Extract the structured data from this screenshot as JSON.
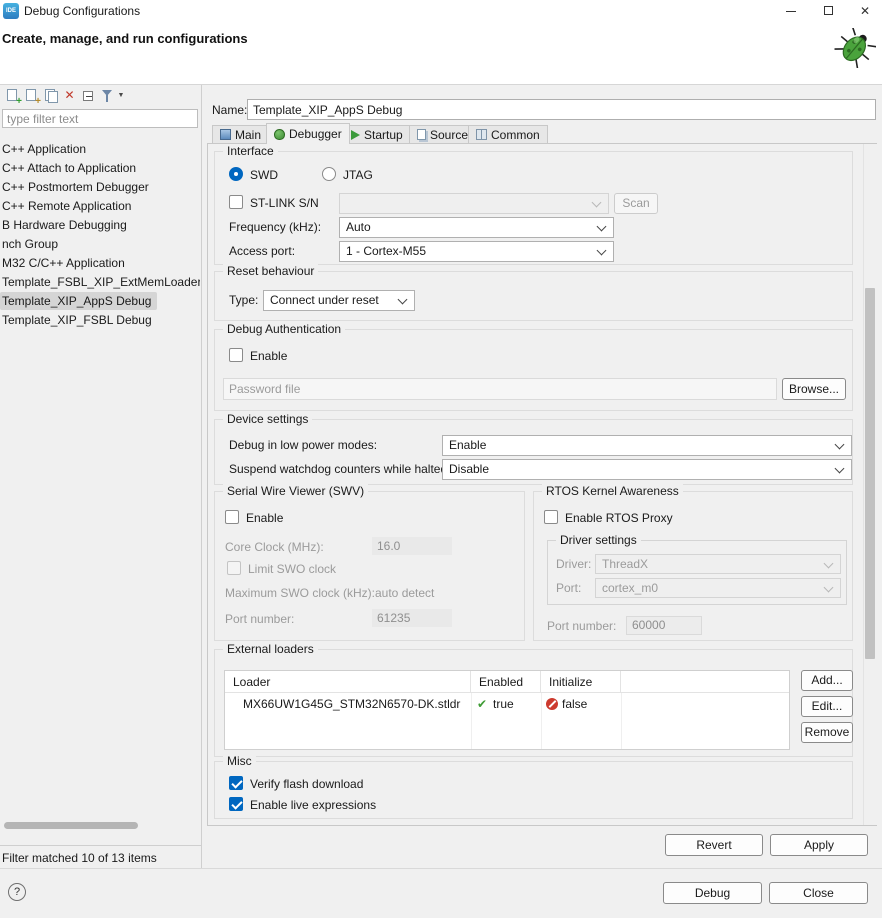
{
  "icons": {
    "app": "IDE",
    "close": "✕",
    "delete": "✕",
    "menu_caret": "▼",
    "help": "?",
    "check_true": "✔"
  },
  "titlebar": {
    "title": "Debug Configurations"
  },
  "header": {
    "title": "Create, manage, and run configurations"
  },
  "sidebar": {
    "filter_placeholder": "type filter text",
    "tree": [
      "C++ Application",
      "C++ Attach to Application",
      "C++ Postmortem Debugger",
      "C++ Remote Application",
      "B Hardware Debugging",
      "nch Group",
      "M32 C/C++ Application",
      "Template_FSBL_XIP_ExtMemLoader De",
      "Template_XIP_AppS Debug",
      "Template_XIP_FSBL Debug"
    ],
    "status": "Filter matched 10 of 13 items"
  },
  "name_row": {
    "label": "Name:",
    "value": "Template_XIP_AppS Debug"
  },
  "tabs": {
    "main": "Main",
    "debugger": "Debugger",
    "startup": "Startup",
    "source": "Source",
    "common": "Common"
  },
  "interface": {
    "legend": "Interface",
    "swd": "SWD",
    "jtag": "JTAG",
    "stlink": "ST-LINK S/N",
    "scan": "Scan",
    "frequency_label": "Frequency (kHz):",
    "frequency_value": "Auto",
    "access_port_label": "Access port:",
    "access_port_value": "1 - Cortex-M55"
  },
  "reset": {
    "legend": "Reset behaviour",
    "type_label": "Type:",
    "type_value": "Connect under reset"
  },
  "auth": {
    "legend": "Debug Authentication",
    "enable": "Enable",
    "password_placeholder": "Password file",
    "browse": "Browse..."
  },
  "device": {
    "legend": "Device settings",
    "low_power_label": "Debug in low power modes:",
    "low_power_value": "Enable",
    "watchdog_label": "Suspend watchdog counters while halted:",
    "watchdog_value": "Disable"
  },
  "swv": {
    "legend": "Serial Wire Viewer (SWV)",
    "enable": "Enable",
    "core_clock_label": "Core Clock (MHz):",
    "core_clock_value": "16.0",
    "limit_swo": "Limit SWO clock",
    "max_swo_label": "Maximum SWO clock (kHz):",
    "max_swo_value": "auto detect",
    "port_label": "Port number:",
    "port_value": "61235"
  },
  "rtos": {
    "legend": "RTOS Kernel Awareness",
    "enable": "Enable RTOS Proxy",
    "driver_group": "Driver settings",
    "driver_label": "Driver:",
    "driver_value": "ThreadX",
    "port_label": "Port:",
    "port_value": "cortex_m0",
    "port_number_label": "Port number:",
    "port_number_value": "60000"
  },
  "loaders": {
    "legend": "External loaders",
    "col_loader": "Loader",
    "col_enabled": "Enabled",
    "col_initialize": "Initialize",
    "row_loader": "MX66UW1G45G_STM32N6570-DK.stldr",
    "row_enabled": "true",
    "row_initialize": "false",
    "add": "Add...",
    "edit": "Edit...",
    "remove": "Remove"
  },
  "misc": {
    "legend": "Misc",
    "verify": "Verify flash download",
    "live": "Enable live expressions"
  },
  "actions": {
    "revert": "Revert",
    "apply": "Apply",
    "debug": "Debug",
    "close": "Close"
  }
}
